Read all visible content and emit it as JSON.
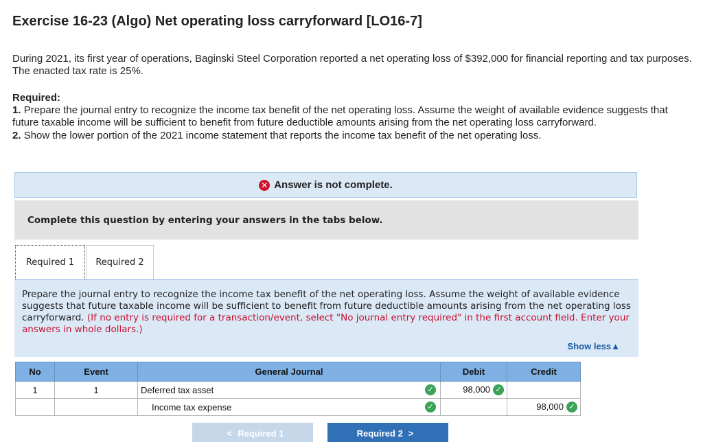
{
  "title": "Exercise 16-23 (Algo) Net operating loss carryforward [LO16-7]",
  "intro": "During 2021, its first year of operations, Baginski Steel Corporation reported a net operating loss of $392,000 for financial reporting and tax purposes. The enacted tax rate is 25%.",
  "required": {
    "heading": "Required:",
    "items": [
      {
        "num": "1.",
        "text": "Prepare the journal entry to recognize the income tax benefit of the net operating loss. Assume the weight of available evidence suggests that future taxable income will be sufficient to benefit from future deductible amounts arising from the net operating loss carryforward."
      },
      {
        "num": "2.",
        "text": "Show the lower portion of the 2021 income statement that reports the income tax benefit of the net operating loss."
      }
    ]
  },
  "alert": "Answer is not complete.",
  "instruction_bar": "Complete this question by entering your answers in the tabs below.",
  "tabs": [
    "Required 1",
    "Required 2"
  ],
  "panel": {
    "text": "Prepare the journal entry to recognize the income tax benefit of the net operating loss. Assume the weight of available evidence suggests that future taxable income will be sufficient to benefit from future deductible amounts arising from the net operating loss carryforward.",
    "note": "(If no entry is required for a transaction/event, select \"No journal entry required\" in the first account field. Enter your answers in whole dollars.)",
    "show_less": "Show less"
  },
  "journal": {
    "headers": {
      "no": "No",
      "event": "Event",
      "general_journal": "General Journal",
      "debit": "Debit",
      "credit": "Credit"
    },
    "rows": [
      {
        "no": "1",
        "event": "1",
        "account": "Deferred tax asset",
        "debit": "98,000",
        "credit": ""
      },
      {
        "no": "",
        "event": "",
        "account": "Income tax expense",
        "debit": "",
        "credit": "98,000"
      }
    ]
  },
  "nav": {
    "prev": "Required 1",
    "next": "Required 2"
  },
  "colors": {
    "header_blue": "#7fb0e3",
    "panel_blue": "#dbe9f7",
    "error_red": "#d0112b",
    "check_green": "#3aa357",
    "next_button": "#2f70b7"
  }
}
